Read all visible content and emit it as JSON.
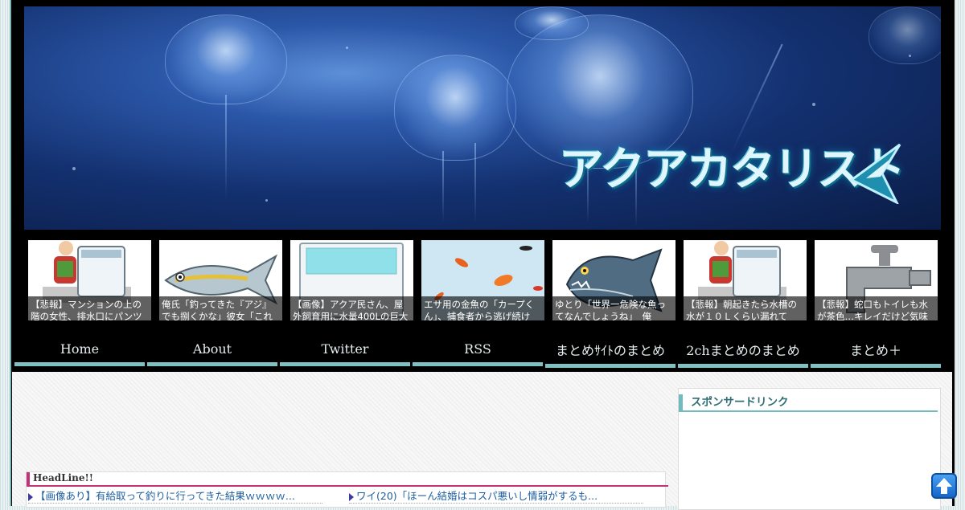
{
  "site": {
    "logo_text": "アクアカタリスト",
    "logo_icon": "fish-fin-icon"
  },
  "feed": [
    {
      "caption": "【悲報】マンションの上の階の女性、排水口にパンツ",
      "image": "washing-machine-illustration"
    },
    {
      "caption": "俺氏「釣ってきた『アジ』でも捌くかな」彼女「これ",
      "image": "horse-mackerel-fish-illustration"
    },
    {
      "caption": "【画像】アクア民さん、屋外飼育用に水量400Lの巨大",
      "image": "water-tank-illustration"
    },
    {
      "caption": "エサ用の金魚の「カープくん」、捕食者から逃げ続け",
      "image": "goldfish-illustration"
    },
    {
      "caption": "ゆとり「世界一危険な魚ってなんでしょうね」　俺",
      "image": "piranha-illustration"
    },
    {
      "caption": "【悲報】朝起きたら水槽の水が１０Ｌくらい漏れて",
      "image": "washing-machine-illustration"
    },
    {
      "caption": "【悲報】蛇口もトイレも水が茶色…キレイだけど気味",
      "image": "faucet-illustration"
    }
  ],
  "nav": [
    {
      "label": "Home"
    },
    {
      "label": "About"
    },
    {
      "label": "Twitter"
    },
    {
      "label": "RSS"
    },
    {
      "label": "まとめｻｲﾄのまとめ"
    },
    {
      "label": "2chまとめのまとめ"
    },
    {
      "label": "まとめ＋"
    }
  ],
  "headline": {
    "title": "HeadLine!!",
    "links": [
      "【画像あり】有給取って釣りに行ってきた結果ｗｗｗｗ...",
      "ワイ(20)「ほーん結婚はコスパ悪いし情弱がするも..."
    ]
  },
  "sidebar": {
    "title": "スポンサードリンク"
  },
  "colors": {
    "nav_underline": "#7fc0c3",
    "headline_accent": "#c2327a",
    "sidebar_accent": "#6fbbbe",
    "link": "#1d5fa0"
  },
  "icons": {
    "scroll_top": "arrow-up-icon"
  }
}
